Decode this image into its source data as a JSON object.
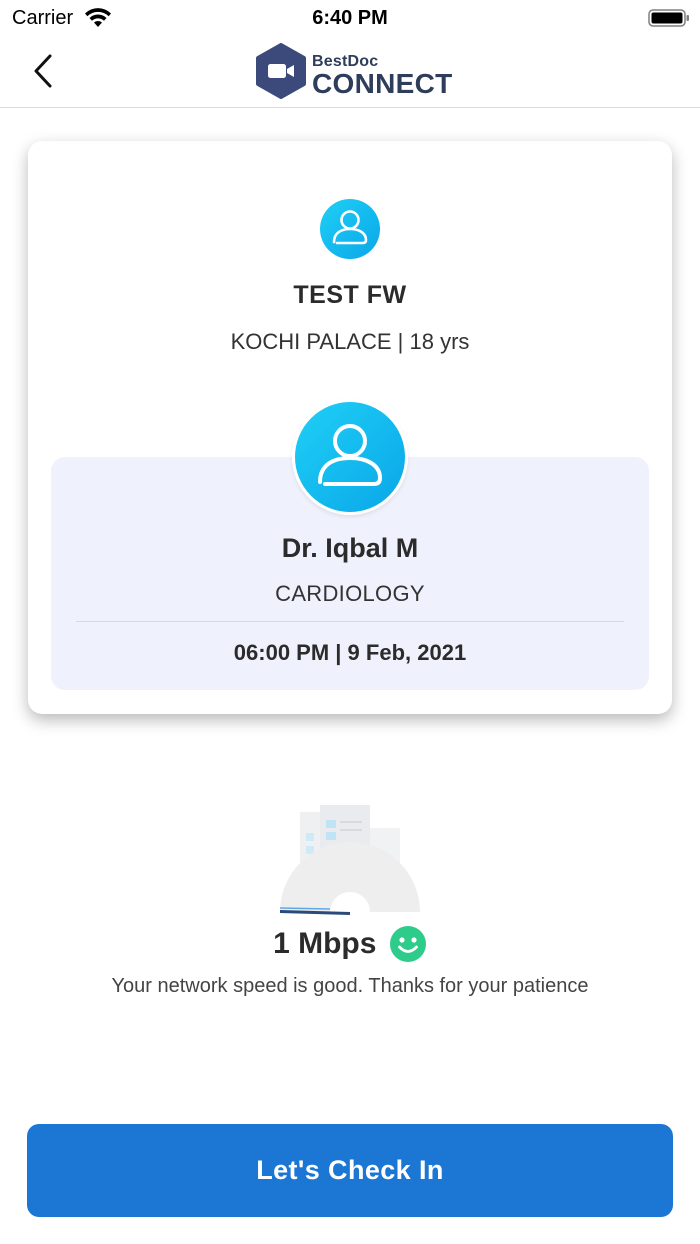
{
  "status_bar": {
    "carrier": "Carrier",
    "time": "6:40 PM"
  },
  "header": {
    "back_icon": "chevron-left-icon",
    "logo_small": "BestDoc",
    "logo_big": "CONNECT",
    "logo_color": "#3b4a7a"
  },
  "patient": {
    "name": "TEST FW",
    "meta": "KOCHI PALACE | 18 yrs"
  },
  "doctor": {
    "name": "Dr. Iqbal M",
    "department": "CARDIOLOGY",
    "appointment": "06:00 PM | 9 Feb, 2021"
  },
  "network": {
    "speed": "1 Mbps",
    "message": "Your network speed is good. Thanks for your patience",
    "status_icon": "smile-icon",
    "status_color": "#2ecc8a"
  },
  "actions": {
    "checkin_label": "Let's Check In",
    "button_color": "#1c77d4"
  },
  "colors": {
    "avatar_gradient_start": "#1fd0f6",
    "avatar_gradient_end": "#0aa6e8",
    "doctor_panel_bg": "#eff1fc"
  }
}
